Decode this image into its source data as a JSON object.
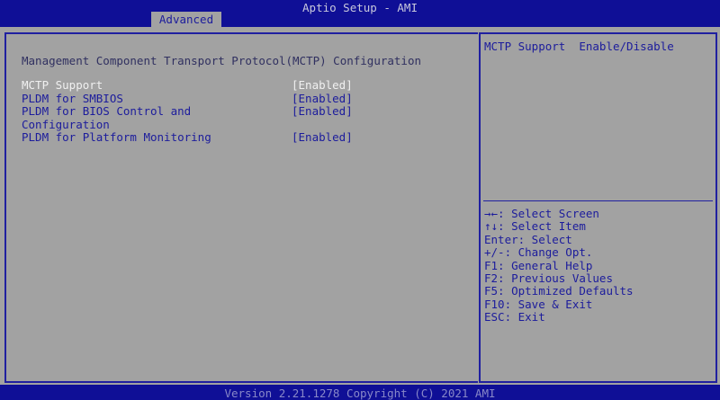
{
  "header": {
    "title": "Aptio Setup - AMI",
    "tabs": [
      {
        "label": "Advanced",
        "active": true
      }
    ]
  },
  "main": {
    "heading": "Management Component Transport Protocol(MCTP) Configuration",
    "items": [
      {
        "label": "MCTP Support",
        "value": "[Enabled]",
        "selected": true
      },
      {
        "label": "PLDM for SMBIOS",
        "value": "[Enabled]"
      },
      {
        "label": "PLDM for BIOS Control and",
        "label2": "Configuration",
        "value": "[Enabled]"
      },
      {
        "label": "PLDM for Platform Monitoring",
        "value": "[Enabled]"
      }
    ]
  },
  "help": {
    "text": "MCTP Support  Enable/Disable"
  },
  "keys": [
    "→←: Select Screen",
    "↑↓: Select Item",
    "Enter: Select",
    "+/-: Change Opt.",
    "F1: General Help",
    "F2: Previous Values",
    "F5: Optimized Defaults",
    "F10: Save & Exit",
    "ESC: Exit"
  ],
  "footer": "Version 2.21.1278 Copyright (C) 2021 AMI",
  "colors": {
    "bar": "#0f0f96",
    "panel": "#a2a2a2",
    "text": "#1c1c9c",
    "selected": "#f0f0f0"
  }
}
